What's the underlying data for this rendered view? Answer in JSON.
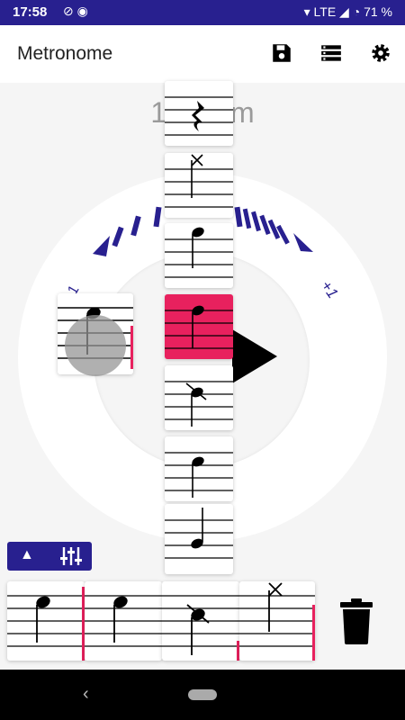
{
  "status_bar": {
    "time": "17:58",
    "network": "LTE",
    "battery": "71 %"
  },
  "app_bar": {
    "title": "Metronome"
  },
  "tempo": {
    "bpm_text": "12▮▮pm"
  },
  "dial": {
    "plus_label": "+1",
    "minus_label": "-1"
  },
  "bottom_controls": {
    "toggle": "▲"
  },
  "colors": {
    "primary": "#28208f",
    "accent": "#e8215e"
  }
}
